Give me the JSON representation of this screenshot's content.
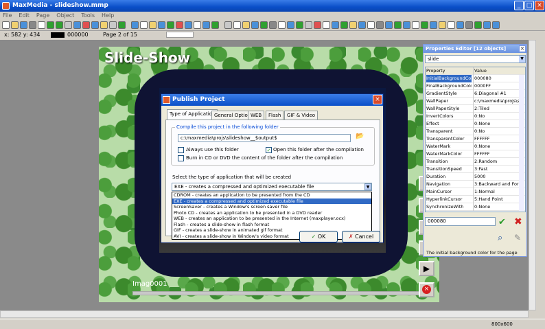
{
  "window": {
    "title": "MaxMedia - slideshow.mmp",
    "minimize": "_",
    "maximize": "□",
    "close": "×"
  },
  "menu": [
    "File",
    "Edit",
    "Page",
    "Object",
    "Tools",
    "Help"
  ],
  "infobar": {
    "coords": "x: 582  y: 434",
    "color_value": "000000",
    "page": "Page 2 of 15"
  },
  "slide": {
    "title": "Slide-Show",
    "caption": "Imag0001"
  },
  "dialog": {
    "title": "Publish Project",
    "tabs": [
      "Type of Application",
      "General Options",
      "WEB",
      "Flash",
      "GIF & Video"
    ],
    "folder_group_label": "Compile this project in the following folder",
    "folder_path": "c:\\maxmedia\\projs\\slideshow__$output$",
    "always_use_folder": "Always use this folder",
    "open_folder": "Open this folder after the compilation",
    "burn_cd": "Burn in CD or DVD the content of the folder after the compilation",
    "type_label": "Select the type of application that will be created",
    "selected_type": "EXE - creates a compressed and optimized executable file",
    "options": [
      "CDROM - creates an application to be presented from the CD",
      "EXE - creates a compressed and optimized executable file",
      "ScreenSaver - creates a Window's screen saver file",
      "Photo CD - creates an application to be presented in a DVD reader",
      "WEB - creates an application to be presented in the Internet (maxplayer.ocx)",
      "Flash - creates a slide-show in flash format",
      "GIF - creates a slide-show in animated gif format",
      "AVI - creates a slide-show in Window's video format"
    ],
    "ok": "OK",
    "cancel": "Cancel"
  },
  "props": {
    "title": "Properties Editor [12 objects]",
    "object": "slide",
    "col_property": "Property",
    "col_value": "Value",
    "rows": [
      [
        "InitialBackgroundColor",
        "000080"
      ],
      [
        "FinalBackgroundColor",
        "0000FF"
      ],
      [
        "GradientStyle",
        "6:Diagonal #1"
      ],
      [
        "WallPaper",
        "c:\\maxmedia\\projs\\slic"
      ],
      [
        "WallPaperStyle",
        "2:Tiled"
      ],
      [
        "InvertColors",
        "0:No"
      ],
      [
        "Effect",
        "0:None"
      ],
      [
        "Transparent",
        "0:No"
      ],
      [
        "TransparentColor",
        "FFFFFF"
      ],
      [
        "WaterMark",
        "0:None"
      ],
      [
        "WaterMarkColor",
        "FFFFFF"
      ],
      [
        "Transition",
        "2:Random"
      ],
      [
        "TransitionSpeed",
        "3:Fast"
      ],
      [
        "Duration",
        "5000"
      ],
      [
        "Navigation",
        "3:Backward and Forw"
      ],
      [
        "MainCursor",
        "1:Normal"
      ],
      [
        "HyperlinkCursor",
        "5:Hand Point"
      ],
      [
        "SynchronizeWith",
        "0:None"
      ]
    ],
    "edit_value": "000080",
    "description": "The initial background color for the page"
  },
  "status": {
    "resolution": "800x600"
  }
}
